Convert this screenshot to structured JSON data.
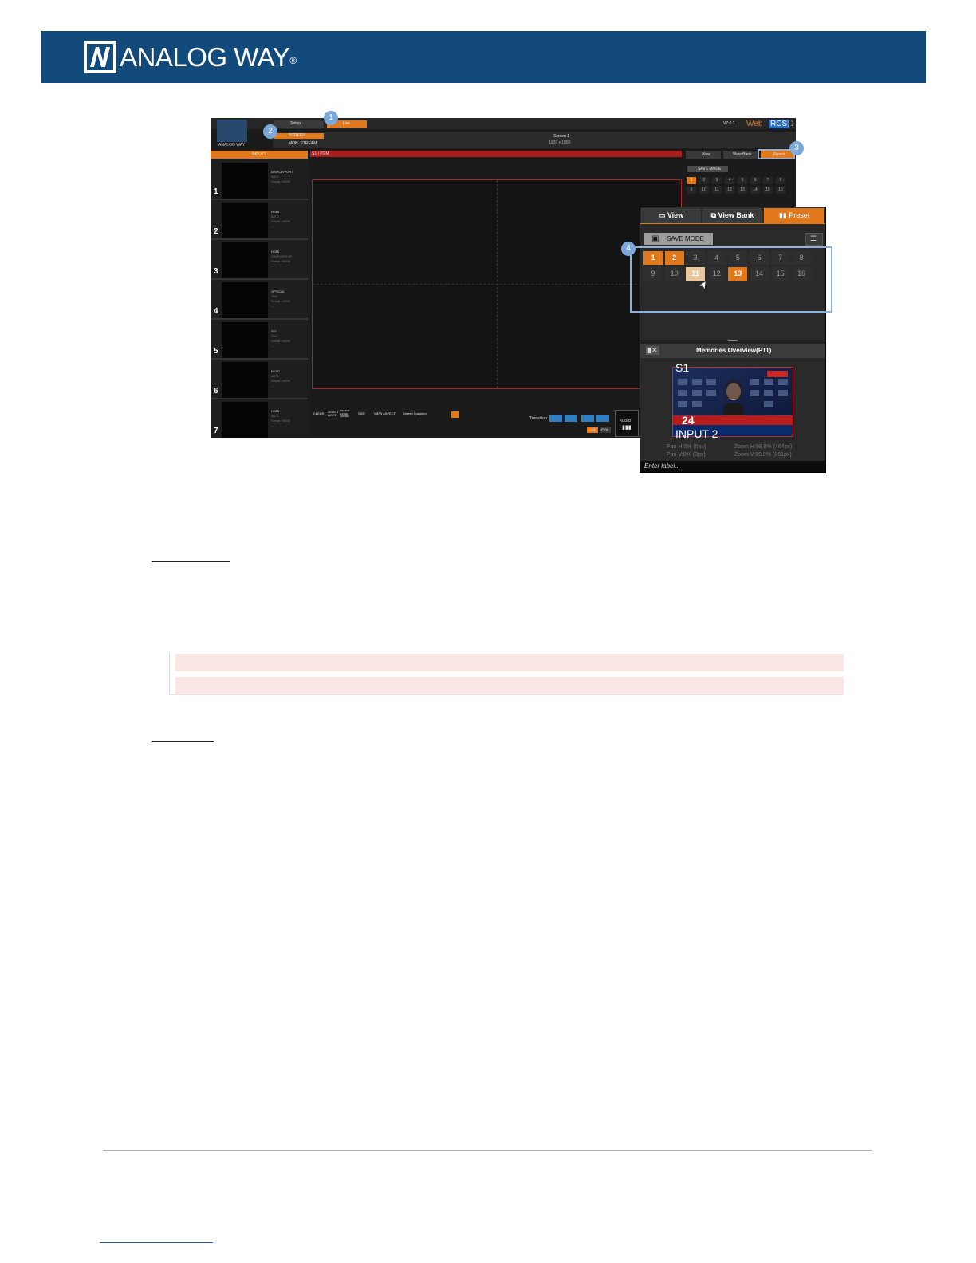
{
  "header": {
    "brand": "ANALOG WAY",
    "reg_mark": "®"
  },
  "app": {
    "logo_caption": "ANALOG WAY",
    "top_tabs": [
      "Setup",
      "Live"
    ],
    "version": "V7.0.1",
    "web": "Web",
    "rcs": "RCS",
    "screen_row": "SCREEN",
    "screen_row2": "MON. STREAM",
    "screen_title": "Screen 1",
    "screen_res": "1920 x 1080",
    "inputs_header": "INPUTS",
    "program_label": "S1 | PGM",
    "right_tabs": [
      "View",
      "View Bank",
      "Preset"
    ],
    "save_mode_small": "SAVE MODE",
    "inputs": [
      {
        "num": "1",
        "name": "DISPLAYPORT",
        "sub": "AUTO\nFormat : NONE\n---"
      },
      {
        "num": "2",
        "name": "HDMI",
        "sub": "AUTO\nFormat : NONE\n---"
      },
      {
        "num": "3",
        "name": "HDMI",
        "sub": "COMPUTER HP\nFormat : NONE\n---"
      },
      {
        "num": "4",
        "name": "OPTICAL",
        "sub": "TWO\nFormat : NONE\n---"
      },
      {
        "num": "5",
        "name": "SDI",
        "sub": "TWO\nFormat : NONE\n---"
      },
      {
        "num": "6",
        "name": "DVI-D",
        "sub": "AUTO\nFormat : NONE\n---"
      },
      {
        "num": "7",
        "name": "HDMI",
        "sub": "AUTO\nFormat : NONE\n---"
      }
    ],
    "toolbar": [
      "CLEAR",
      "SELECT\nLAYER",
      "SELECT\nLAYER\nORDER",
      "SIZE",
      "VIEW ASPECT",
      "Screen Snapshot"
    ],
    "transition_label": "Transition",
    "audio_label": "AUDIO",
    "take_labels": [
      "LIVE",
      "PVW"
    ]
  },
  "overlay": {
    "tabs": [
      "View",
      "View Bank",
      "Preset"
    ],
    "save_mode": "SAVE MODE",
    "presets_row1": [
      "1",
      "2",
      "3",
      "4",
      "5",
      "6",
      "7",
      "8"
    ],
    "presets_row2": [
      "9",
      "10",
      "11",
      "12",
      "13",
      "14",
      "15",
      "16"
    ],
    "memories_title": "Memories Overview(P11)",
    "thumb_screen": "S1",
    "thumb_input": "INPUT 2",
    "thumb_channel": "24",
    "pan_h": "Pan H:0% (0px)",
    "pan_v": "Pan V:0% (0px)",
    "zoom_h": "Zoom H:99.8% (464px)",
    "zoom_v": "Zoom V:99.8% (861px)",
    "label_placeholder": "Enter label..."
  },
  "callouts": [
    "1",
    "2",
    "3",
    "4"
  ],
  "colors": {
    "banner": "#124a7c",
    "accent": "#e2781c",
    "callout": "#7ba7d9"
  }
}
